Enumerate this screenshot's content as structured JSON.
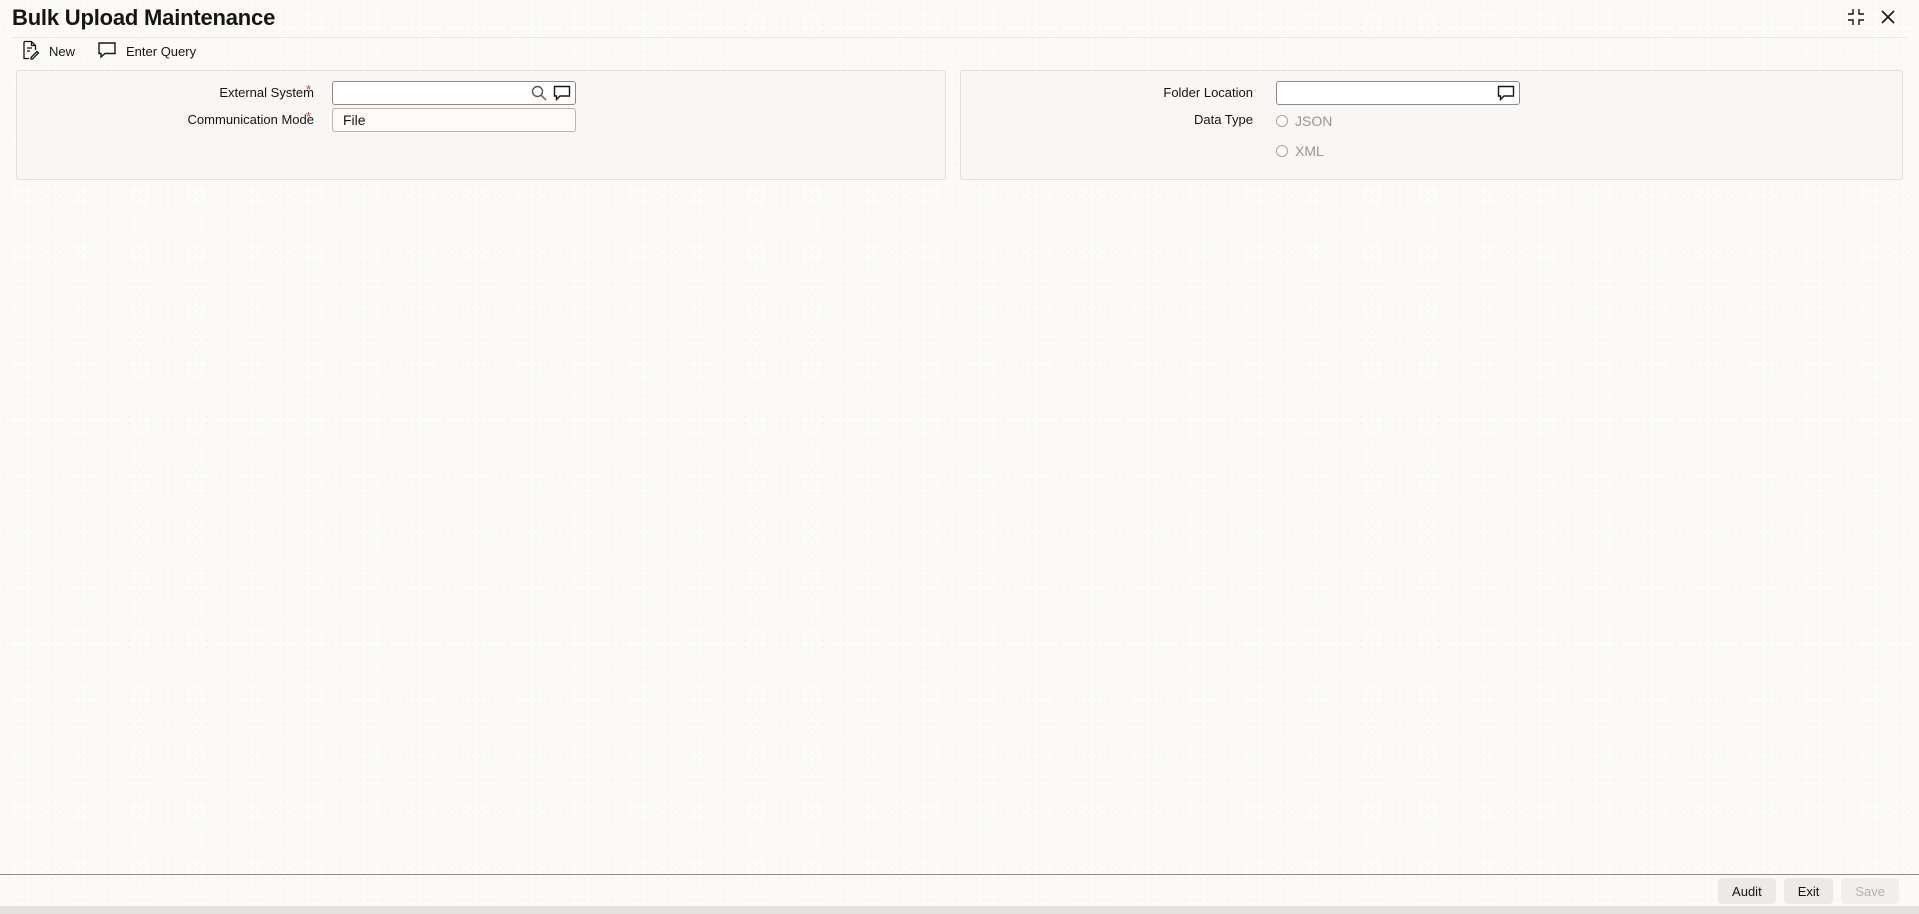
{
  "window": {
    "title": "Bulk Upload Maintenance",
    "controls": {
      "minimize_icon": "collapse-icon",
      "close_icon": "close-icon"
    }
  },
  "toolbar": {
    "new_label": "New",
    "new_icon": "new-document-icon",
    "enter_query_label": "Enter Query",
    "enter_query_icon": "speech-bubble-icon"
  },
  "left_panel": {
    "external_system": {
      "label": "External System",
      "required_marker": "*",
      "value": "",
      "search_icon": "search-icon",
      "lov_icon": "speech-bubble-icon"
    },
    "communication_mode": {
      "label": "Communication Mode",
      "required_marker": "*",
      "value": "File"
    }
  },
  "right_panel": {
    "folder_location": {
      "label": "Folder Location",
      "value": "",
      "lov_icon": "speech-bubble-icon"
    },
    "data_type": {
      "label": "Data Type",
      "options": [
        "JSON",
        "XML"
      ],
      "selected": null
    }
  },
  "footer": {
    "audit_label": "Audit",
    "exit_label": "Exit",
    "save_label": "Save"
  },
  "colors": {
    "required": "#c74634",
    "text": "#161513",
    "disabled_text": "#b5b0ab",
    "panel_bg": "#f8f7f6",
    "border": "#8f8a85"
  }
}
